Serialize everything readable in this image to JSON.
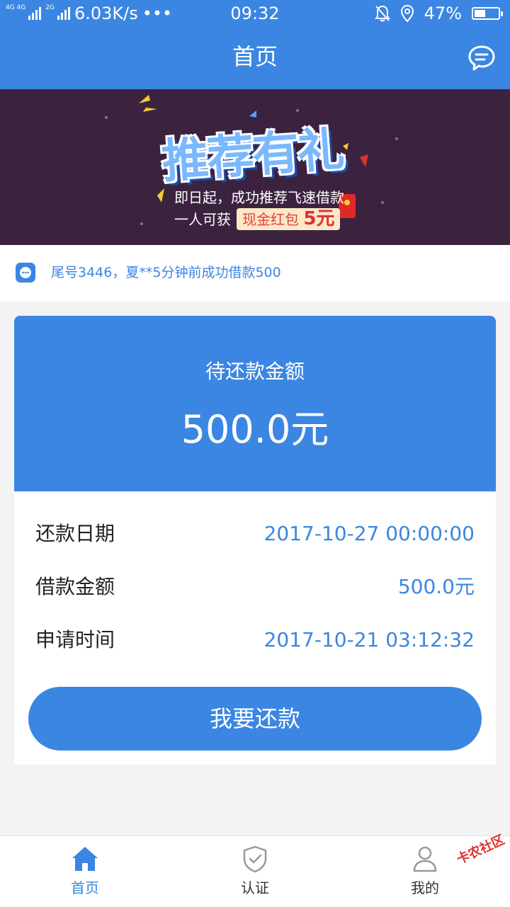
{
  "status_bar": {
    "network_speed": "6.03K/s",
    "more": "•••",
    "time": "09:32",
    "battery_percent": "47%",
    "battery_level": 0.47,
    "signal_tags": [
      "4G 4G",
      "2G"
    ]
  },
  "header": {
    "title": "首页",
    "message_icon": "chat-bubble-icon"
  },
  "banner": {
    "title": "推荐有礼",
    "line1": "即日起，成功推荐飞速借款",
    "line2_prefix": "一人可获",
    "pill_text": "现金红包",
    "pill_amount": "5元"
  },
  "notice": {
    "icon": "chat-bubble-icon",
    "text": "尾号3446，夏**5分钟前成功借款500"
  },
  "card": {
    "label": "待还款金额",
    "amount": "500.0元",
    "rows": [
      {
        "key": "还款日期",
        "value": "2017-10-27 00:00:00"
      },
      {
        "key": "借款金额",
        "value": "500.0元"
      },
      {
        "key": "申请时间",
        "value": "2017-10-21 03:12:32"
      }
    ],
    "button_label": "我要还款"
  },
  "tabbar": {
    "items": [
      {
        "label": "首页",
        "icon": "home-icon",
        "active": true
      },
      {
        "label": "认证",
        "icon": "shield-check-icon",
        "active": false
      },
      {
        "label": "我的",
        "icon": "user-icon",
        "active": false
      }
    ]
  },
  "watermark": "卡农社区",
  "colors": {
    "primary": "#3b86e2",
    "banner_bg": "#3b2340",
    "page_bg": "#f3f3f3"
  }
}
